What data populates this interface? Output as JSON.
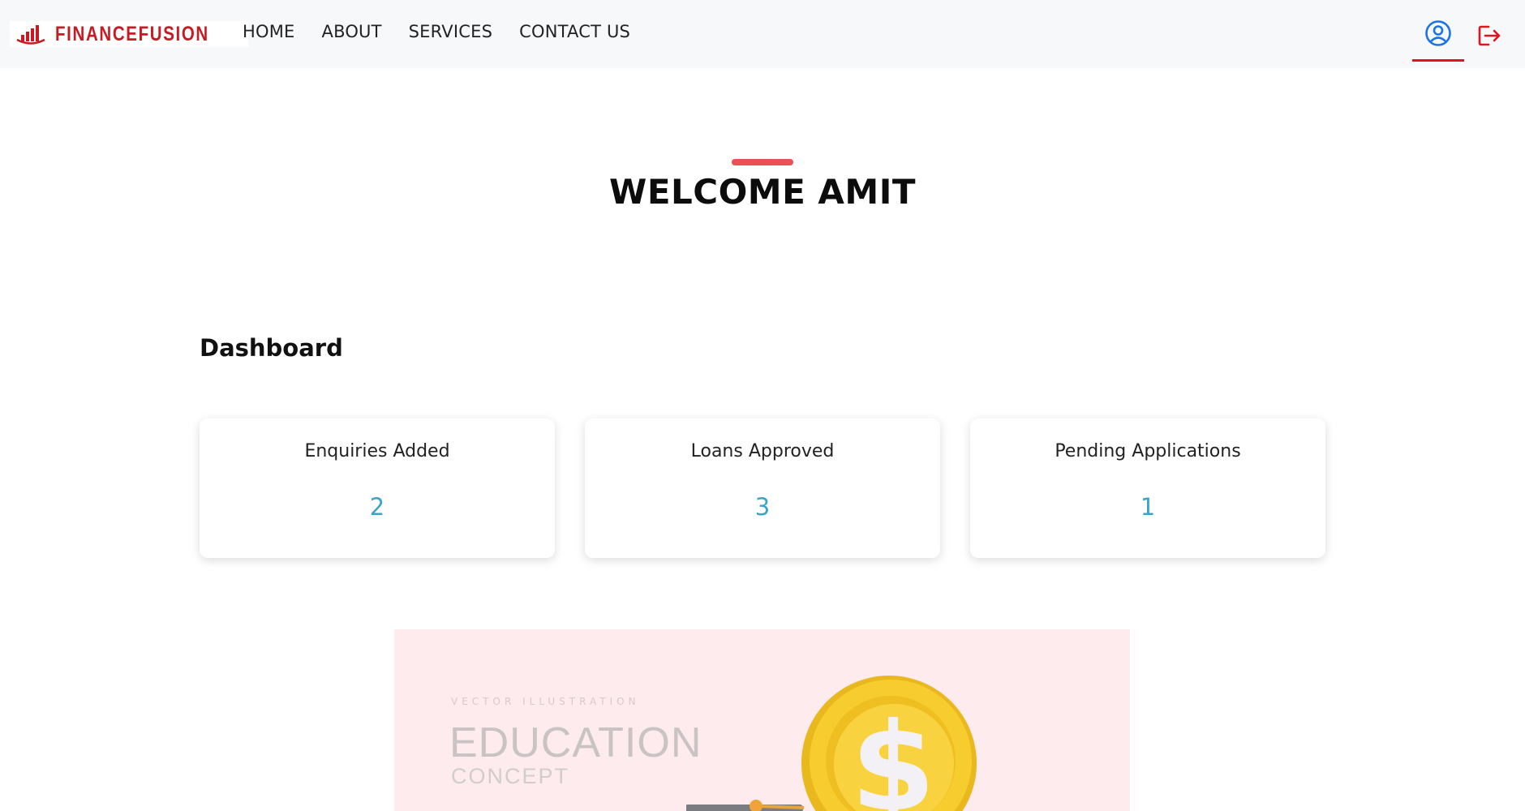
{
  "brand": {
    "name": "FINANCEFUSION",
    "color": "#c61b23",
    "icon": "bar-chart-logo-icon"
  },
  "nav": {
    "items": [
      "HOME",
      "ABOUT",
      "SERVICES",
      "CONTACT US"
    ]
  },
  "header_actions": {
    "user_icon": "user-circle-icon",
    "logout_icon": "logout-icon",
    "active_color": "#e0141c",
    "user_icon_color": "#1a73e8"
  },
  "welcome": {
    "title": "WELCOME AMIT",
    "accent_color": "#ec5056"
  },
  "dashboard": {
    "title": "Dashboard",
    "cards": [
      {
        "label": "Enquiries Added",
        "value": "2"
      },
      {
        "label": "Loans Approved",
        "value": "3"
      },
      {
        "label": "Pending Applications",
        "value": "1"
      }
    ],
    "value_color": "#3aa3c8"
  },
  "banner": {
    "small_text": "VECTOR ILLUSTRATION",
    "title": "EDUCATION",
    "subtitle": "CONCEPT",
    "background": "#fdebed",
    "art_icons": [
      "graduation-cap-icon",
      "dollar-coin-icon"
    ]
  }
}
